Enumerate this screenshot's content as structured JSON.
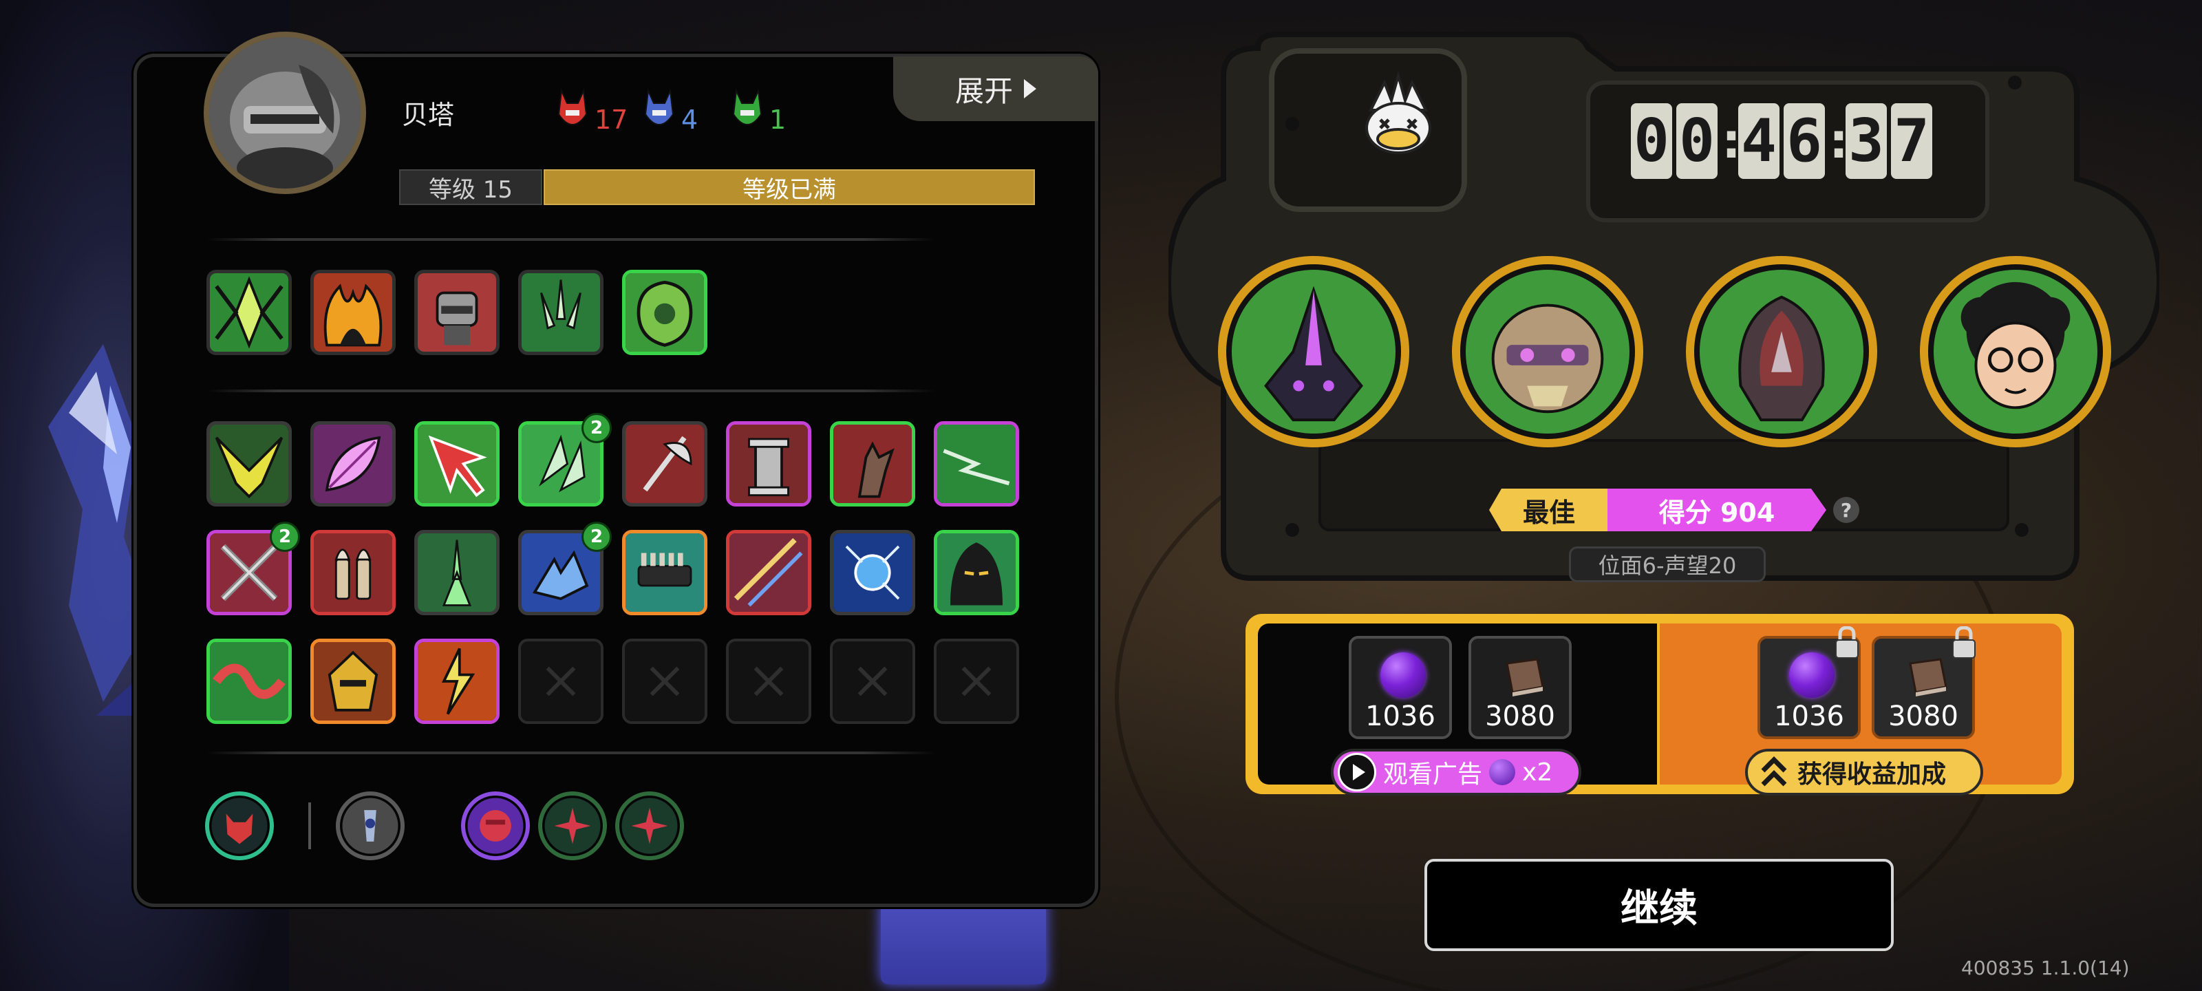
{
  "character": {
    "name": "贝塔",
    "level_label": "等级 15",
    "level_status": "等级已满",
    "level_progress": 1.0,
    "expand_label": "展开"
  },
  "factions": [
    {
      "icon": "red-faction-icon",
      "count": "17",
      "color": "#e0433e"
    },
    {
      "icon": "blue-faction-icon",
      "count": "4",
      "color": "#5f8fe0"
    },
    {
      "icon": "green-faction-icon",
      "count": "1",
      "color": "#49c24e"
    }
  ],
  "equipped_skills": [
    {
      "icon": "green-crystal-blade-icon",
      "border": "#2f2f2f"
    },
    {
      "icon": "flame-demon-icon",
      "border": "#2f2f2f"
    },
    {
      "icon": "armored-fist-icon",
      "border": "#2f2f2f"
    },
    {
      "icon": "green-claw-icon",
      "border": "#2f2f2f"
    },
    {
      "icon": "green-armor-icon",
      "border": "#3ad44a"
    }
  ],
  "inventory": [
    {
      "icon": "yellow-wings-icon",
      "border": "#3a3a3a",
      "badge": null
    },
    {
      "icon": "pink-feather-icon",
      "border": "#3a3a3a",
      "badge": null
    },
    {
      "icon": "red-arrow-icon",
      "border": "#3ad44a",
      "badge": null
    },
    {
      "icon": "green-shards-icon",
      "border": "#3ad44a",
      "badge": "2"
    },
    {
      "icon": "battle-axe-icon",
      "border": "#3a3a3a",
      "badge": null
    },
    {
      "icon": "stone-pillar-icon",
      "border": "#c443d6",
      "badge": null
    },
    {
      "icon": "grabbing-hand-icon",
      "border": "#3ad44a",
      "badge": null
    },
    {
      "icon": "green-lightning-icon",
      "border": "#c443d6",
      "badge": null
    },
    {
      "icon": "crossed-swords-icon",
      "border": "#c443d6",
      "badge": "2"
    },
    {
      "icon": "bullets-icon",
      "border": "#d23a3a",
      "badge": null
    },
    {
      "icon": "green-burst-icon",
      "border": "#3a3a3a",
      "badge": null
    },
    {
      "icon": "blue-dragon-icon",
      "border": "#3a3a3a",
      "badge": "2"
    },
    {
      "icon": "ammo-belt-icon",
      "border": "#f08a2a",
      "badge": null
    },
    {
      "icon": "light-slash-icon",
      "border": "#d23a3a",
      "badge": null
    },
    {
      "icon": "electric-orb-icon",
      "border": "#3a3a3a",
      "badge": null
    },
    {
      "icon": "hooded-figure-icon",
      "border": "#3ad44a",
      "badge": null
    },
    {
      "icon": "red-ribbon-icon",
      "border": "#3ad44a",
      "badge": null
    },
    {
      "icon": "golden-helm-icon",
      "border": "#f08a2a",
      "badge": null
    },
    {
      "icon": "fire-lightning-icon",
      "border": "#c443d6",
      "badge": null
    }
  ],
  "empty_slots": 5,
  "traits": [
    {
      "icon": "demon-face-icon",
      "ring": "#2fbf8f"
    },
    {
      "icon": "tower-crest-icon",
      "ring": "#5a5a5a"
    },
    {
      "icon": "fist-icon",
      "ring": "#8a4de0"
    },
    {
      "icon": "red-star-icon",
      "ring": "#2f6a3a"
    },
    {
      "icon": "red-star-icon",
      "ring": "#2f6a3a"
    }
  ],
  "timer": {
    "digits": [
      "0",
      "0",
      "4",
      "6",
      "3",
      "7"
    ],
    "mascot_icon": "duck-mascot-icon"
  },
  "team": [
    {
      "icon": "dark-crystal-mech-icon"
    },
    {
      "icon": "tribal-mask-icon"
    },
    {
      "icon": "hooded-beast-icon"
    },
    {
      "icon": "curly-hair-glasses-icon"
    }
  ],
  "score": {
    "best_label": "最佳",
    "score_label": "得分 904",
    "help": "?",
    "plane_label": "位面6-声望20"
  },
  "rewards": {
    "base": [
      {
        "icon": "purple-orb-icon",
        "count": "1036"
      },
      {
        "icon": "book-icon",
        "count": "3080"
      }
    ],
    "bonus": [
      {
        "icon": "purple-orb-icon",
        "count": "1036",
        "locked": true
      },
      {
        "icon": "book-icon",
        "count": "3080",
        "locked": true
      }
    ],
    "ad_label": "观看广告",
    "ad_multiplier": "x2",
    "bonus_label": "获得收益加成"
  },
  "continue_label": "继续",
  "version": "400835 1.1.0(14)",
  "colors": {
    "accent_gold": "#f2ba2b",
    "bonus_orange": "#e87a1f",
    "score_magenta": "#e452ee",
    "level_bar": "#b8902d"
  }
}
